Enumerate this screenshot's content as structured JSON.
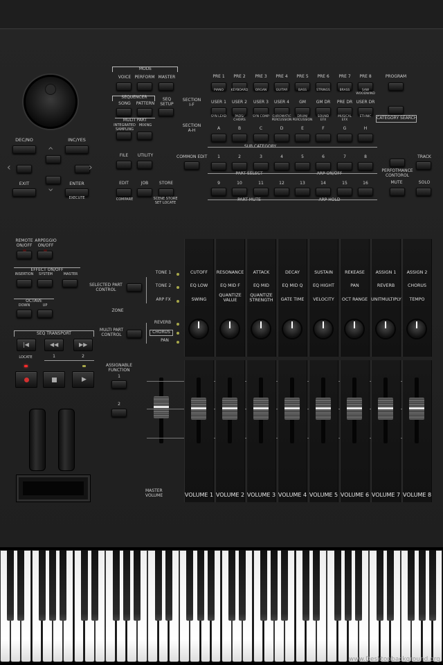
{
  "panel": {
    "dec_no": "DEC/NO",
    "inc_yes": "INC/YES",
    "exit": "EXIT",
    "enter": "ENTER",
    "execute": "EXECUTE",
    "mode": {
      "title": "MODE",
      "voice": "VOICE",
      "perform": "PERFORM",
      "master": "MASTER"
    },
    "sequencer": {
      "title": "SEQUENCER",
      "song": "SONG",
      "pattern": "PATTERN",
      "seq_setup": "SEQ\nSETUP",
      "multi_part": "MULTI PART",
      "integrated_sampling": "INTEGRATED\nSAMPLING",
      "mixing": "MIXING"
    },
    "file": "FILE",
    "utility": "UTILITY",
    "edit": "EDIT",
    "job": "JOB",
    "store": "STORE",
    "compare": "COMPARE",
    "scene_store": "SCENE STORE\nSET LOCATE",
    "pre_labels": [
      "PRE 1",
      "PRE 2",
      "PRE 3",
      "PRE 4",
      "PRE 5",
      "PRE 6",
      "PRE 7",
      "PRE 8"
    ],
    "program": "PROGRAM",
    "cat_row1": [
      "PIANO",
      "KEYBOARD",
      "ORGAN",
      "GUITAR",
      "BASS",
      "STRINGS",
      "BRASS",
      "SAW\nWOODWIND"
    ],
    "section_if": "SECTION\nI-F",
    "user_labels": [
      "USER 1",
      "USER 2",
      "USER 3",
      "USER 4",
      "GM",
      "GM DR",
      "PRE DR",
      "USER DR"
    ],
    "cat_row2": [
      "SYN LEAD",
      "PADS/\nCHOIRS",
      "SYN COMP",
      "CHROMATIC\nPERCUSSION",
      "DRUM/\nPERCUSSION",
      "SOUND\nEFX",
      "MUSICAL\nEFX",
      "ETHNIC"
    ],
    "category_search": "CATEGORY SEARCH",
    "section_ah": "SECTION\nA-H",
    "letters": [
      "A",
      "B",
      "C",
      "D",
      "E",
      "F",
      "G",
      "H"
    ],
    "sub_category": "SUB CATEGORY",
    "common_edit": "COMMON EDIT",
    "nums1": [
      "1",
      "2",
      "3",
      "4",
      "5",
      "6",
      "7",
      "8"
    ],
    "track": "TRACK",
    "part_select": "PART SELECT",
    "arp_on_off": "ARP ON/OFF",
    "performance_control": "PERFOTMANCE\nCONTOROL",
    "nums2": [
      "9",
      "10",
      "11",
      "12",
      "13",
      "14",
      "15",
      "16"
    ],
    "mute": "MUTE",
    "solo": "SOLO",
    "part_mute": "PART MUTE",
    "arp_hold": "ARP HOLD",
    "remote": "REMOTE\nON/OFF",
    "arpeggio": "ARPEGGIO\nON/OFF",
    "effect": {
      "title": "EFFECT ON/OFF",
      "insertion": "INSERTION",
      "system": "SYSTEM",
      "master": "MASTER"
    },
    "octave": {
      "title": "OCTAVE",
      "down": "DOWN",
      "up": "UP"
    },
    "seq_transport": "SEQ TRANSPORT",
    "locate": "LOCATE",
    "locate_1": "1",
    "locate_2": "2",
    "assignable": "ASSIGNABLE\nFUNCTION",
    "assign_1": "1",
    "assign_2": "2",
    "selected_part": "SELECTED PART\nCONTROL",
    "zone": "ZONE",
    "multi_part_control": "MULTI PART\nCONTROL",
    "tone1": "TONE 1",
    "tone2": "TONE 2",
    "arp_fx": "ARP FX",
    "reverb": "REVERB",
    "chorus": "CHORUS",
    "pan": "PAN",
    "master_volume": "MASTER\nVOLUME"
  },
  "strips": {
    "row1": [
      "CUTOFF",
      "RESONANCE",
      "ATTACK",
      "DECAY",
      "SUSTAIN",
      "REKEASE",
      "ASSIGN 1",
      "ASSIGN 2"
    ],
    "row2": [
      "EQ LOW",
      "EQ  MID F",
      "EQ  MID",
      "EQ MID Q",
      "EQ HIGHT",
      "PAN",
      "REVERB",
      "CHORUS"
    ],
    "row3": [
      "SWING",
      "QUANTIZE\nVALUE",
      "QUANTIZE\nSTRENGTH",
      "GATE TIME",
      "VELOCITY",
      "OCT RANGE",
      "UNITMULTIPLY",
      "TEMPO"
    ],
    "volumes": [
      "VOLUME 1",
      "VOLUME 2",
      "VOLUME 3",
      "VOLUME 4",
      "VOLUME 5",
      "VOLUME 6",
      "VOLUME 7",
      "VOLUME 8"
    ]
  },
  "watermark": "www.Desktopbackground.org",
  "colors": {
    "panel": "#222222",
    "led_off": "#4a1414",
    "led_on": "#ff2a2a",
    "led_amber": "#a8a84a"
  }
}
